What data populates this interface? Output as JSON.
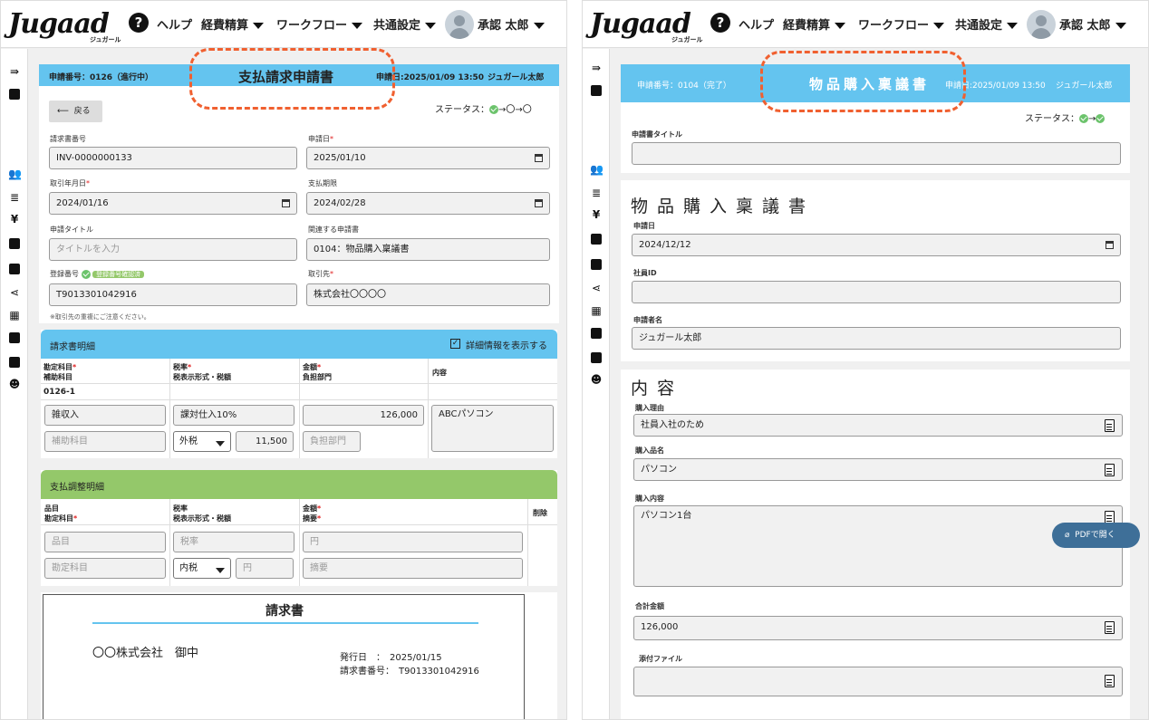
{
  "logo": {
    "text": "Jugaad",
    "sub": "ジュガール"
  },
  "nav": {
    "help": "ヘルプ",
    "expense": "経費精算",
    "workflow": "ワークフロー",
    "shared": "共通設定",
    "user": "承認 太郎"
  },
  "left": {
    "header": {
      "number": "申請番号：0126（進行中）",
      "title": "支払請求申請書",
      "date": "申請日:2025/01/09 13:50",
      "user": "ジュガール太郎"
    },
    "back": "戻る",
    "status_label": "ステータス：",
    "status_steps": "→〇→〇",
    "fields": {
      "invoice_no_label": "請求書番号",
      "invoice_no": "INV-0000000133",
      "apply_date_label": "申請日",
      "apply_date": "2025/01/10",
      "txn_month_label": "取引年月日",
      "txn_month": "2024/01/16",
      "due_label": "支払期限",
      "due": "2024/02/28",
      "title_label": "申請タイトル",
      "title_ph": "タイトルを入力",
      "related_label": "関連する申請書",
      "related": "0104：物品購入稟議書",
      "reg_label": "登録番号",
      "reg_badge": "登録番号確認済",
      "reg": "T9013301042916",
      "partner_label": "取引先",
      "partner": "株式会社〇〇〇〇",
      "note": "※取引先の重複にご注意ください。"
    },
    "detail": {
      "title": "請求書明細",
      "toggle": "詳細情報を表示する",
      "h1a": "勘定科目",
      "h1b": "補助科目",
      "h2a": "税率",
      "h2b": "税表示形式・税額",
      "h3a": "金額",
      "h3b": "負担部門",
      "h4": "内容",
      "row_id": "0126-1",
      "account": "雑収入",
      "sub_ph": "補助科目",
      "tax": "課対仕入10%",
      "tax_mode": "外税",
      "tax_amt": "11,500",
      "amount": "126,000",
      "dept_ph": "負担部門",
      "content": "ABCパソコン"
    },
    "adjust": {
      "title": "支払調整明細",
      "h1a": "品目",
      "h1b": "勘定科目",
      "h2a": "税率",
      "h2b": "税表示形式・税額",
      "h3a": "金額",
      "h3b": "摘要",
      "h4": "削除",
      "item_ph": "品目",
      "rate_ph": "税率",
      "amount_ph": "円",
      "account_ph": "勘定科目",
      "mode": "内税",
      "yen_ph": "円",
      "memo_ph": "摘要"
    },
    "invoice": {
      "title": "請求書",
      "to": "〇〇株式会社　御中",
      "issue_label": "発行日　：　2025/01/15",
      "num_label": "請求書番号：　T9013301042916"
    }
  },
  "right": {
    "header": {
      "number": "申請番号：0104（完了）",
      "title": "物品購入稟議書",
      "date": "申請日:2025/01/09 13:50",
      "user": "ジュガール太郎"
    },
    "status_label": "ステータス：",
    "status_steps": "→",
    "apply_title_label": "申請書タイトル",
    "section1": "物品購入稟議書",
    "apply_date_label": "申請日",
    "apply_date": "2024/12/12",
    "emp_label": "社員ID",
    "applicant_label": "申請者名",
    "applicant": "ジュガール太郎",
    "section2": "内容",
    "reason_label": "購入理由",
    "reason": "社員入社のため",
    "item_label": "購入品名",
    "item": "パソコン",
    "content_label": "購入内容",
    "content": "パソコン1台",
    "total_label": "合計金額",
    "total": "126,000",
    "file_label": "添付ファイル",
    "pdf_btn": "PDFで開く"
  },
  "colors": {
    "header_blue": "#64c4ef",
    "adjust_green": "#94c86a",
    "highlight": "#f06030"
  }
}
